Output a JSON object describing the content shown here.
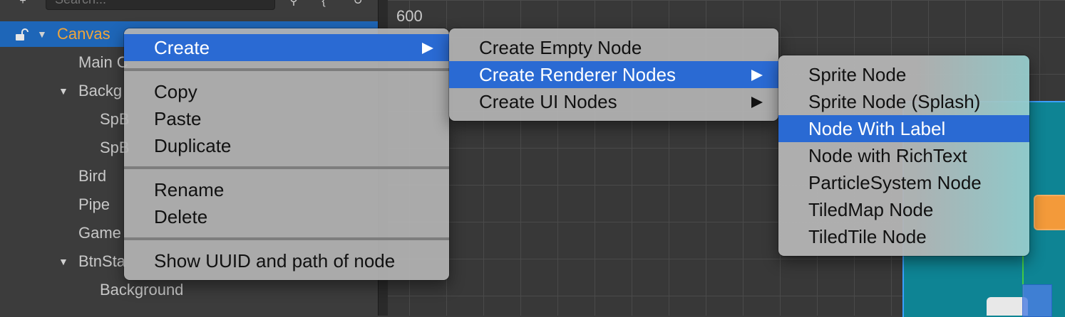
{
  "hierarchy": {
    "search_placeholder": "Search...",
    "rows": [
      {
        "label": "Canvas",
        "expanded": true,
        "selected": true
      },
      {
        "label": "Main C"
      },
      {
        "label": "Backg",
        "expanded": true
      },
      {
        "label": "SpB"
      },
      {
        "label": "SpB"
      },
      {
        "label": "Bird"
      },
      {
        "label": "Pipe"
      },
      {
        "label": "Game"
      },
      {
        "label": "BtnSta",
        "expanded": true
      },
      {
        "label": "Background"
      }
    ]
  },
  "scene": {
    "ruler_label": "600"
  },
  "context_menu": {
    "items": [
      {
        "label": "Create",
        "has_submenu": true,
        "highlighted": true
      },
      {
        "label": "Copy"
      },
      {
        "label": "Paste"
      },
      {
        "label": "Duplicate"
      },
      {
        "label": "Rename"
      },
      {
        "label": "Delete"
      },
      {
        "label": "Show UUID and path of node"
      }
    ]
  },
  "create_menu": {
    "items": [
      {
        "label": "Create Empty Node"
      },
      {
        "label": "Create Renderer Nodes",
        "has_submenu": true,
        "highlighted": true
      },
      {
        "label": "Create UI Nodes",
        "has_submenu": true
      }
    ]
  },
  "renderer_menu": {
    "items": [
      {
        "label": "Sprite Node"
      },
      {
        "label": "Sprite Node (Splash)"
      },
      {
        "label": "Node With Label",
        "highlighted": true
      },
      {
        "label": "Node with RichText"
      },
      {
        "label": "ParticleSystem Node"
      },
      {
        "label": "TiledMap Node"
      },
      {
        "label": "TiledTile Node"
      }
    ]
  },
  "colors": {
    "selection_blue": "#2a6ad3",
    "canvas_label_orange": "#f0a53a",
    "scene_teal": "#0e8494"
  }
}
